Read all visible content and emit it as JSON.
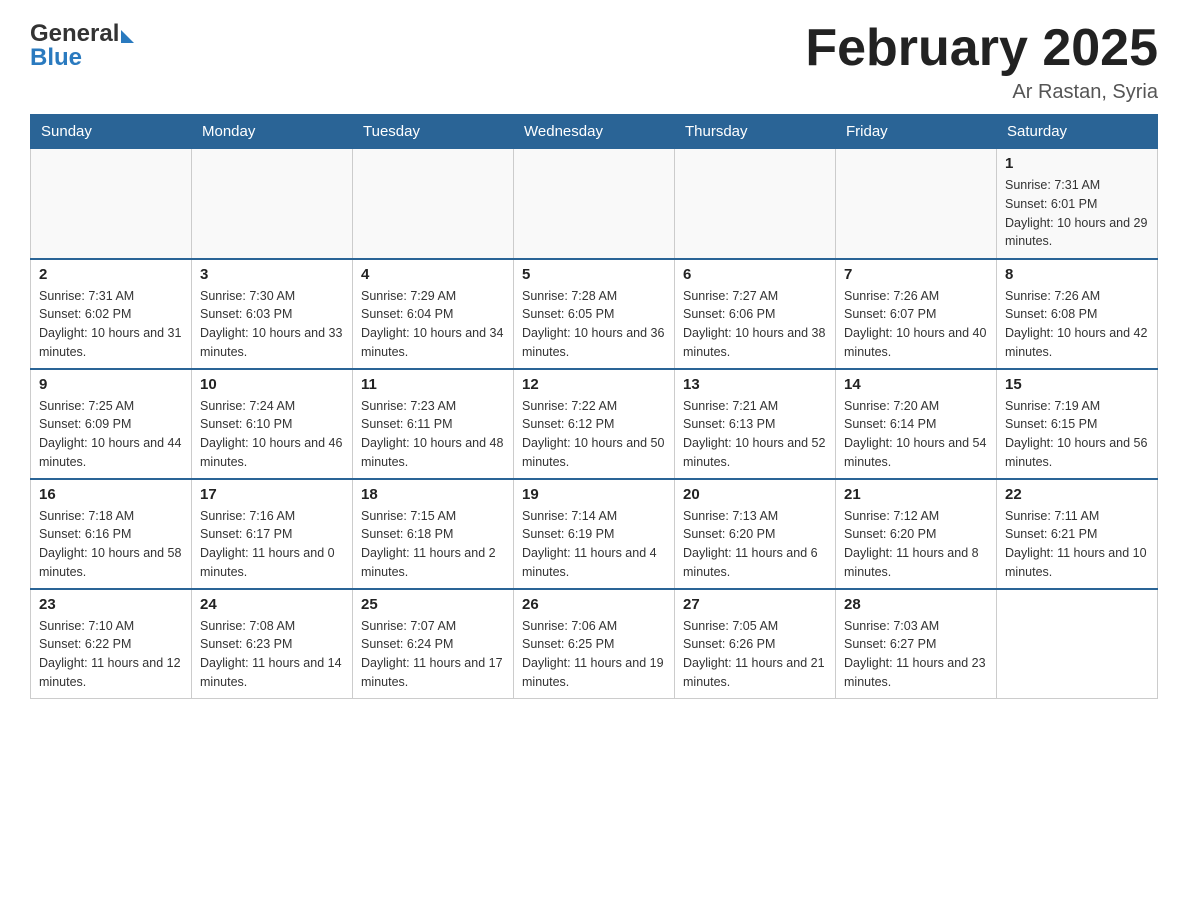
{
  "header": {
    "logo_general": "General",
    "logo_blue": "Blue",
    "month_title": "February 2025",
    "location": "Ar Rastan, Syria"
  },
  "days_of_week": [
    "Sunday",
    "Monday",
    "Tuesday",
    "Wednesday",
    "Thursday",
    "Friday",
    "Saturday"
  ],
  "weeks": [
    [
      {
        "day": "",
        "sunrise": "",
        "sunset": "",
        "daylight": ""
      },
      {
        "day": "",
        "sunrise": "",
        "sunset": "",
        "daylight": ""
      },
      {
        "day": "",
        "sunrise": "",
        "sunset": "",
        "daylight": ""
      },
      {
        "day": "",
        "sunrise": "",
        "sunset": "",
        "daylight": ""
      },
      {
        "day": "",
        "sunrise": "",
        "sunset": "",
        "daylight": ""
      },
      {
        "day": "",
        "sunrise": "",
        "sunset": "",
        "daylight": ""
      },
      {
        "day": "1",
        "sunrise": "Sunrise: 7:31 AM",
        "sunset": "Sunset: 6:01 PM",
        "daylight": "Daylight: 10 hours and 29 minutes."
      }
    ],
    [
      {
        "day": "2",
        "sunrise": "Sunrise: 7:31 AM",
        "sunset": "Sunset: 6:02 PM",
        "daylight": "Daylight: 10 hours and 31 minutes."
      },
      {
        "day": "3",
        "sunrise": "Sunrise: 7:30 AM",
        "sunset": "Sunset: 6:03 PM",
        "daylight": "Daylight: 10 hours and 33 minutes."
      },
      {
        "day": "4",
        "sunrise": "Sunrise: 7:29 AM",
        "sunset": "Sunset: 6:04 PM",
        "daylight": "Daylight: 10 hours and 34 minutes."
      },
      {
        "day": "5",
        "sunrise": "Sunrise: 7:28 AM",
        "sunset": "Sunset: 6:05 PM",
        "daylight": "Daylight: 10 hours and 36 minutes."
      },
      {
        "day": "6",
        "sunrise": "Sunrise: 7:27 AM",
        "sunset": "Sunset: 6:06 PM",
        "daylight": "Daylight: 10 hours and 38 minutes."
      },
      {
        "day": "7",
        "sunrise": "Sunrise: 7:26 AM",
        "sunset": "Sunset: 6:07 PM",
        "daylight": "Daylight: 10 hours and 40 minutes."
      },
      {
        "day": "8",
        "sunrise": "Sunrise: 7:26 AM",
        "sunset": "Sunset: 6:08 PM",
        "daylight": "Daylight: 10 hours and 42 minutes."
      }
    ],
    [
      {
        "day": "9",
        "sunrise": "Sunrise: 7:25 AM",
        "sunset": "Sunset: 6:09 PM",
        "daylight": "Daylight: 10 hours and 44 minutes."
      },
      {
        "day": "10",
        "sunrise": "Sunrise: 7:24 AM",
        "sunset": "Sunset: 6:10 PM",
        "daylight": "Daylight: 10 hours and 46 minutes."
      },
      {
        "day": "11",
        "sunrise": "Sunrise: 7:23 AM",
        "sunset": "Sunset: 6:11 PM",
        "daylight": "Daylight: 10 hours and 48 minutes."
      },
      {
        "day": "12",
        "sunrise": "Sunrise: 7:22 AM",
        "sunset": "Sunset: 6:12 PM",
        "daylight": "Daylight: 10 hours and 50 minutes."
      },
      {
        "day": "13",
        "sunrise": "Sunrise: 7:21 AM",
        "sunset": "Sunset: 6:13 PM",
        "daylight": "Daylight: 10 hours and 52 minutes."
      },
      {
        "day": "14",
        "sunrise": "Sunrise: 7:20 AM",
        "sunset": "Sunset: 6:14 PM",
        "daylight": "Daylight: 10 hours and 54 minutes."
      },
      {
        "day": "15",
        "sunrise": "Sunrise: 7:19 AM",
        "sunset": "Sunset: 6:15 PM",
        "daylight": "Daylight: 10 hours and 56 minutes."
      }
    ],
    [
      {
        "day": "16",
        "sunrise": "Sunrise: 7:18 AM",
        "sunset": "Sunset: 6:16 PM",
        "daylight": "Daylight: 10 hours and 58 minutes."
      },
      {
        "day": "17",
        "sunrise": "Sunrise: 7:16 AM",
        "sunset": "Sunset: 6:17 PM",
        "daylight": "Daylight: 11 hours and 0 minutes."
      },
      {
        "day": "18",
        "sunrise": "Sunrise: 7:15 AM",
        "sunset": "Sunset: 6:18 PM",
        "daylight": "Daylight: 11 hours and 2 minutes."
      },
      {
        "day": "19",
        "sunrise": "Sunrise: 7:14 AM",
        "sunset": "Sunset: 6:19 PM",
        "daylight": "Daylight: 11 hours and 4 minutes."
      },
      {
        "day": "20",
        "sunrise": "Sunrise: 7:13 AM",
        "sunset": "Sunset: 6:20 PM",
        "daylight": "Daylight: 11 hours and 6 minutes."
      },
      {
        "day": "21",
        "sunrise": "Sunrise: 7:12 AM",
        "sunset": "Sunset: 6:20 PM",
        "daylight": "Daylight: 11 hours and 8 minutes."
      },
      {
        "day": "22",
        "sunrise": "Sunrise: 7:11 AM",
        "sunset": "Sunset: 6:21 PM",
        "daylight": "Daylight: 11 hours and 10 minutes."
      }
    ],
    [
      {
        "day": "23",
        "sunrise": "Sunrise: 7:10 AM",
        "sunset": "Sunset: 6:22 PM",
        "daylight": "Daylight: 11 hours and 12 minutes."
      },
      {
        "day": "24",
        "sunrise": "Sunrise: 7:08 AM",
        "sunset": "Sunset: 6:23 PM",
        "daylight": "Daylight: 11 hours and 14 minutes."
      },
      {
        "day": "25",
        "sunrise": "Sunrise: 7:07 AM",
        "sunset": "Sunset: 6:24 PM",
        "daylight": "Daylight: 11 hours and 17 minutes."
      },
      {
        "day": "26",
        "sunrise": "Sunrise: 7:06 AM",
        "sunset": "Sunset: 6:25 PM",
        "daylight": "Daylight: 11 hours and 19 minutes."
      },
      {
        "day": "27",
        "sunrise": "Sunrise: 7:05 AM",
        "sunset": "Sunset: 6:26 PM",
        "daylight": "Daylight: 11 hours and 21 minutes."
      },
      {
        "day": "28",
        "sunrise": "Sunrise: 7:03 AM",
        "sunset": "Sunset: 6:27 PM",
        "daylight": "Daylight: 11 hours and 23 minutes."
      },
      {
        "day": "",
        "sunrise": "",
        "sunset": "",
        "daylight": ""
      }
    ]
  ]
}
